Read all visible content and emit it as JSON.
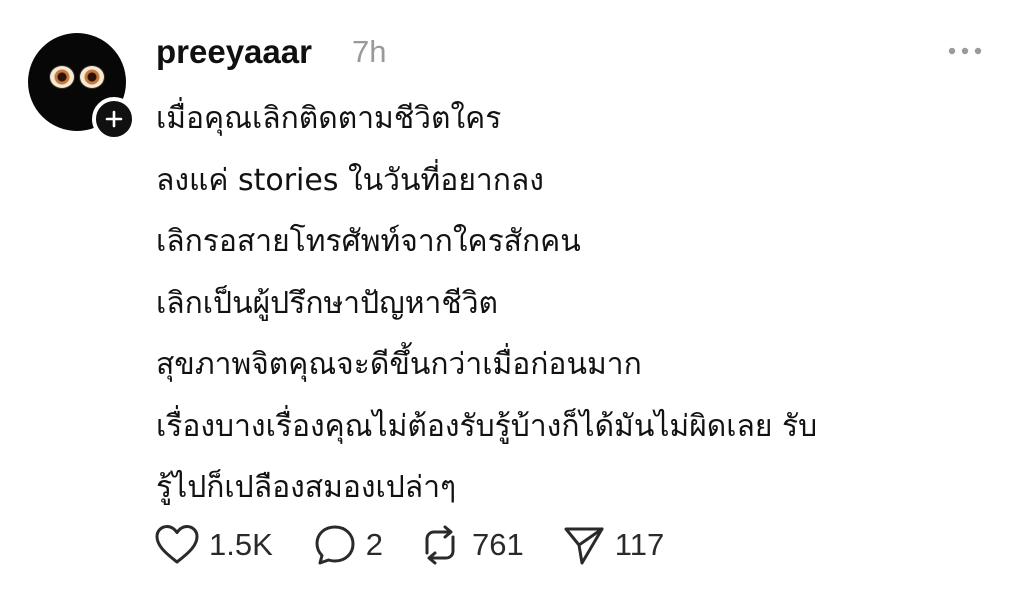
{
  "post": {
    "username": "preeyaaar",
    "timestamp": "7h",
    "lines": [
      "เมื่อคุณเลิกติดตามชีวิตใคร",
      "ลงแค่ stories ในวันที่อยากลง",
      "เลิกรอสายโทรศัพท์จากใครสักคน",
      "เลิกเป็นผู้ปรึกษาปัญหาชีวิต",
      "สุขภาพจิตคุณจะดีขึ้นกว่าเมื่อก่อนมาก",
      "เรื่องบางเรื่องคุณไม่ต้องรับรู้บ้างก็ได้มันไม่ผิดเลย รับ",
      "รู้ไปก็เปลืองสมองเปล่าๆ"
    ]
  },
  "actions": {
    "likes": "1.5K",
    "replies": "2",
    "reposts": "761",
    "shares": "117"
  },
  "icons": {
    "like": "heart-icon",
    "reply": "comment-bubble-icon",
    "repost": "repost-icon",
    "share": "send-icon",
    "more": "more-dots-icon",
    "follow": "plus-icon"
  },
  "colors": {
    "text": "#101010",
    "muted": "#9a9a9a",
    "background": "#ffffff"
  }
}
